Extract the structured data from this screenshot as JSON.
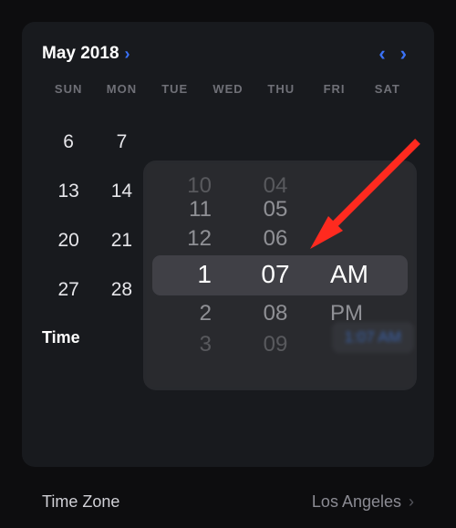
{
  "header": {
    "month_label": "May 2018",
    "month_chevron": "›",
    "prev": "‹",
    "next": "›"
  },
  "dow": {
    "sun": "SUN",
    "mon": "MON",
    "tue": "TUE",
    "wed": "WED",
    "thu": "THU",
    "fri": "FRI",
    "sat": "SAT"
  },
  "weeks": {
    "w1": {
      "c0": "6",
      "c1": "7"
    },
    "w2": {
      "c0": "13",
      "c1": "14"
    },
    "w3": {
      "c0": "20",
      "c1": "21"
    },
    "w4": {
      "c0": "27",
      "c1": "28"
    }
  },
  "time": {
    "label": "Time",
    "value": "1:07 AM"
  },
  "timezone": {
    "label": "Time Zone",
    "value": "Los Angeles",
    "chevron": "›"
  },
  "wheel": {
    "hour": {
      "minus3": "10",
      "minus2": "11",
      "minus1": "12",
      "sel": "1",
      "plus1": "2",
      "plus2": "3"
    },
    "minute": {
      "minus3": "04",
      "minus2": "05",
      "minus1": "06",
      "sel": "07",
      "plus1": "08",
      "plus2": "09"
    },
    "period": {
      "sel": "AM",
      "plus1": "PM"
    }
  },
  "annotation": {
    "arrow": "red-arrow"
  }
}
